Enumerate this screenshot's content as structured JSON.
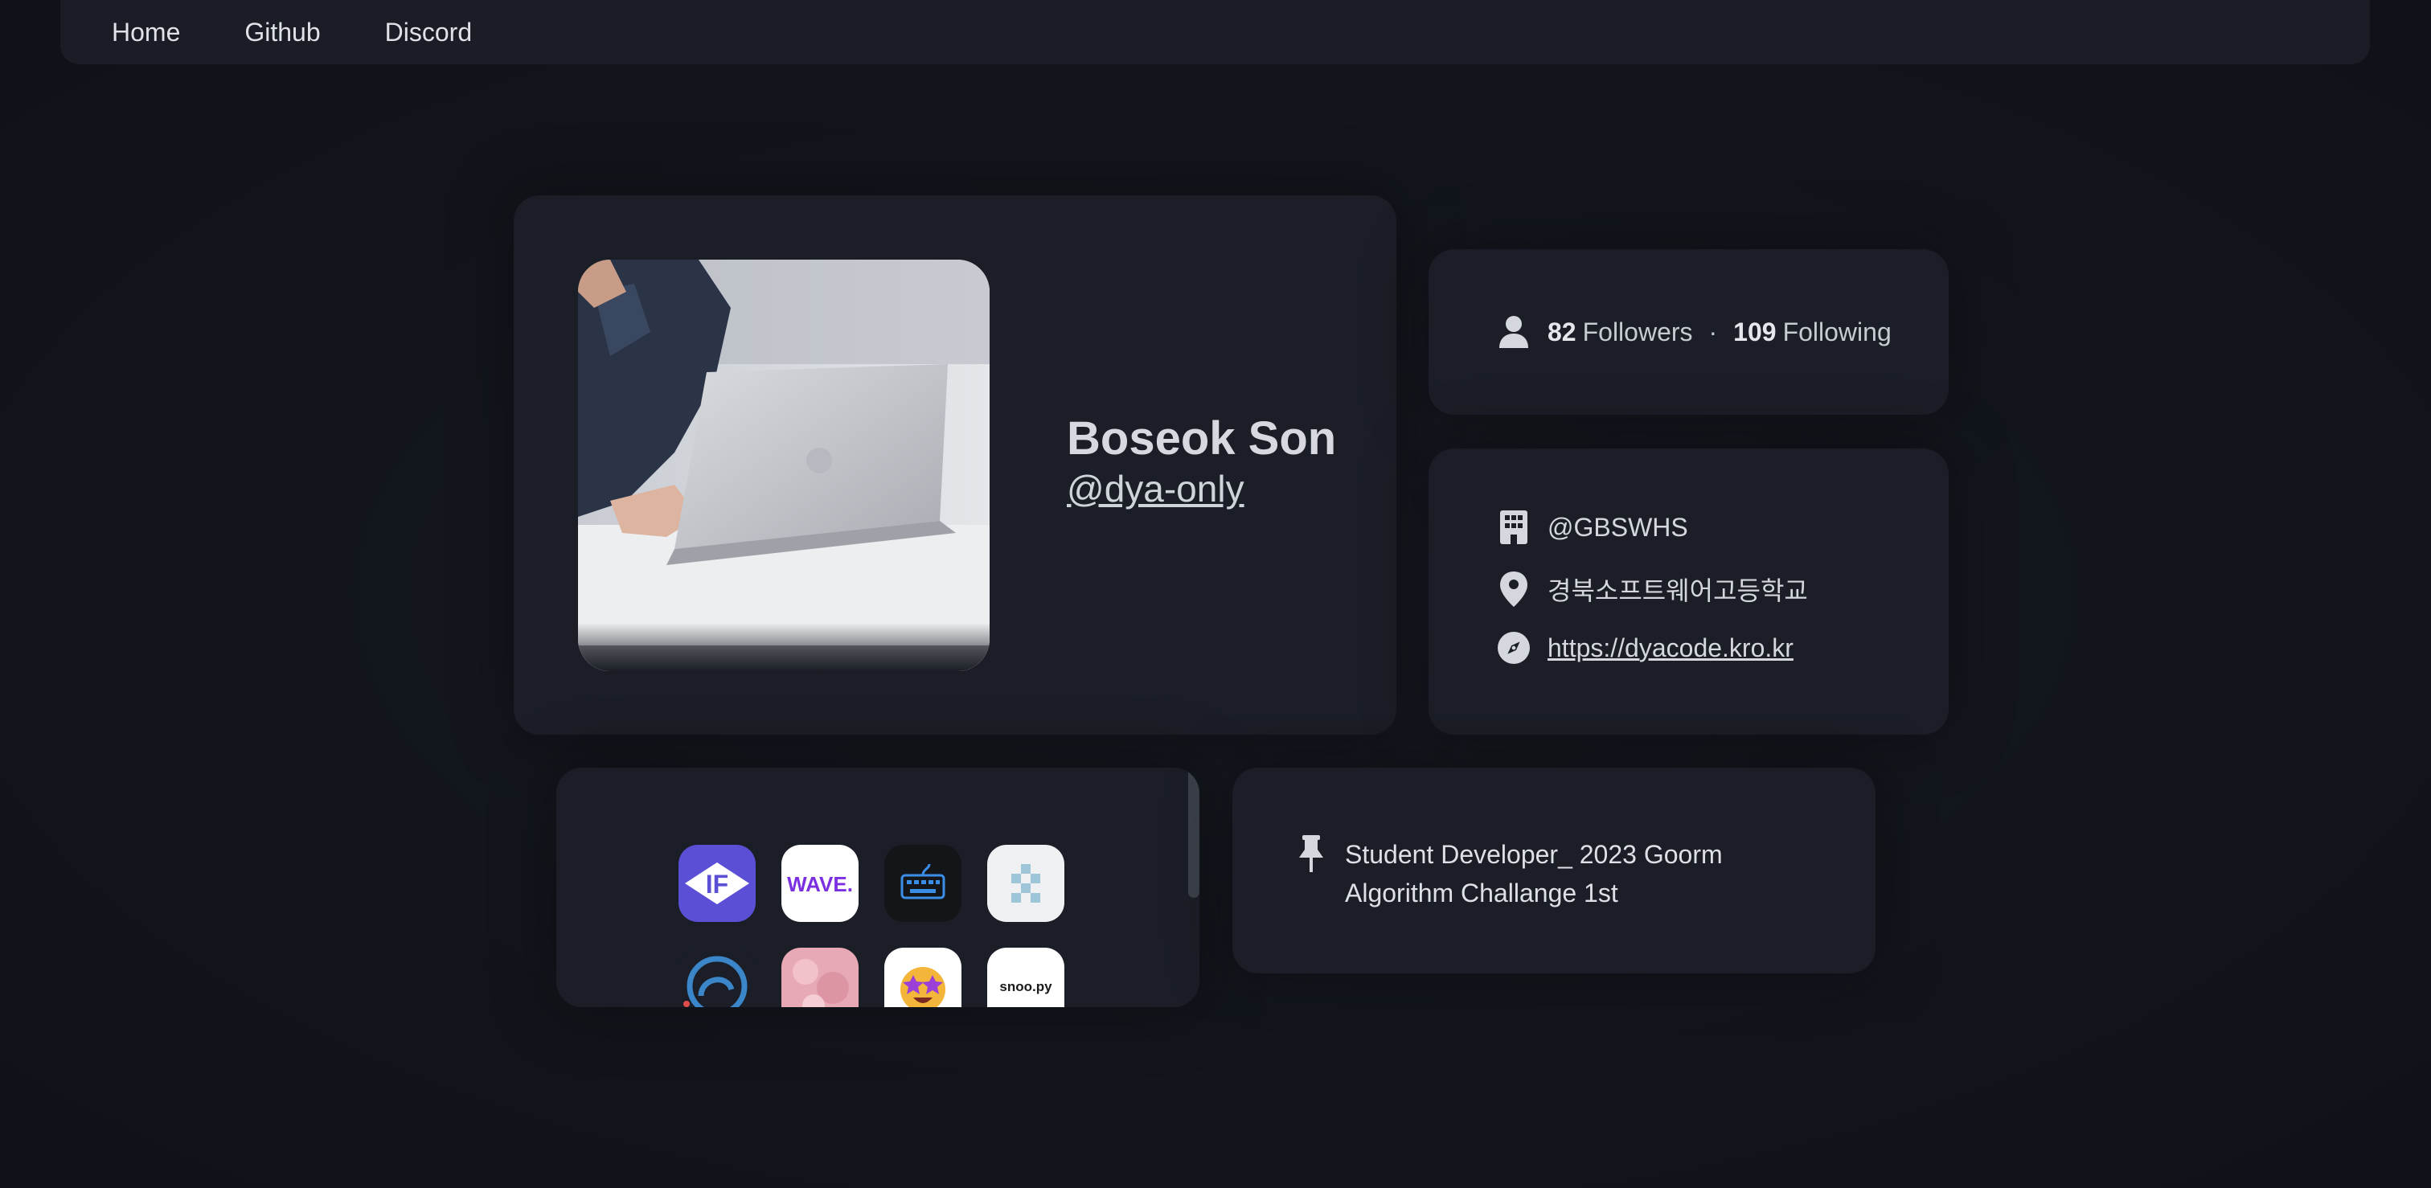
{
  "nav": {
    "items": [
      "Home",
      "Github",
      "Discord"
    ]
  },
  "profile": {
    "name": "Boseok Son",
    "handle": "@dya-only"
  },
  "stats": {
    "followers_count": "82",
    "followers_label": "Followers",
    "separator": "·",
    "following_count": "109",
    "following_label": "Following"
  },
  "info": {
    "organization": "@GBSWHS",
    "location": "경북소프트웨어고등학교",
    "website": "https://dyacode.kro.kr"
  },
  "apps": {
    "icons": [
      {
        "name": "if-app-icon",
        "text": "IF",
        "bg": "#5b4fd6",
        "fg": "#ffffff"
      },
      {
        "name": "wave-app-icon",
        "text": "WAVE.",
        "bg": "#ffffff",
        "fg": "#7b2fe0"
      },
      {
        "name": "keyboard-app-icon",
        "text": "",
        "bg": "#141518",
        "fg": "#3b8ee8"
      },
      {
        "name": "checker-app-icon",
        "text": "",
        "bg": "#eef0f2",
        "fg": "#9fc6d8"
      },
      {
        "name": "swirl-app-icon",
        "text": "",
        "bg": "#1b1e26",
        "fg": "#3a86c9"
      },
      {
        "name": "pink-app-icon",
        "text": "",
        "bg": "#e8a9b6",
        "fg": "#ffffff"
      },
      {
        "name": "star-eyes-app-icon",
        "text": "",
        "bg": "#ffffff",
        "fg": "#f4b63a"
      },
      {
        "name": "snoopy-app-icon",
        "text": "snoo.py",
        "bg": "#ffffff",
        "fg": "#1a1a1a"
      }
    ]
  },
  "pinned": {
    "text": "Student Developer_ 2023 Goorm Algorithm Challange 1st"
  },
  "colors": {
    "background": "#13161d",
    "card": "#1b1e26",
    "text": "#d9dce2"
  }
}
